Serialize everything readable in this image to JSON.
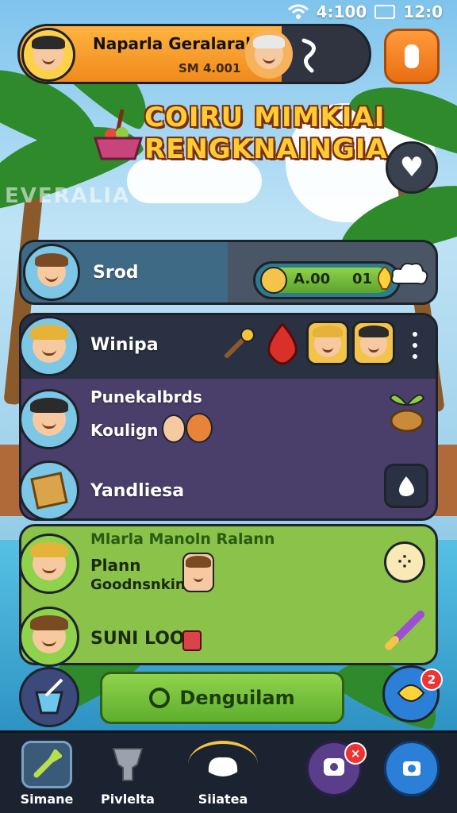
{
  "status_bar": {
    "time": "4:100",
    "battery": "12:0"
  },
  "profile": {
    "name": "Naparla Geralaral",
    "sub": "SM 4.001"
  },
  "title": {
    "line1": "COIRU MIMKIAI",
    "line2": "RENGKNAINGIA"
  },
  "watermark": "EVERALIA",
  "rows": [
    {
      "label": "Srod",
      "pill_value": "A.00",
      "pill_level": "01"
    },
    {
      "label": "Winipa"
    },
    {
      "label": "Punekalbrds",
      "sublabel": "Koulign"
    },
    {
      "label": "Yandliesa"
    },
    {
      "header": "Mlarla Manoln Ralann",
      "label": "Plann",
      "sublabel": "Goodnsnkin"
    },
    {
      "label": "SUNI LOOo"
    }
  ],
  "cta": {
    "label": "Denguilam"
  },
  "bottom_nav": [
    {
      "label": "Simane"
    },
    {
      "label": "Pivlelta"
    },
    {
      "label": "Siiatea"
    },
    {
      "label": ""
    },
    {
      "label": ""
    }
  ],
  "badges": {
    "gift": "2",
    "chat": "×"
  },
  "icons": [
    "wifi-icon",
    "battery-icon",
    "menu-icon",
    "heart-icon",
    "cloud-icon",
    "more-icon",
    "leaf-icon",
    "seed-icon",
    "dots-icon",
    "brush-icon",
    "bucket-icon",
    "gift-icon",
    "hammer-icon",
    "trophy-icon",
    "sheep-icon",
    "chat-icon",
    "camera-icon"
  ],
  "colors": {
    "accent_orange": "#f08a1c",
    "accent_green": "#5fae2d",
    "panel_dark": "#2f3440",
    "panel_purple": "#4a3f6b"
  }
}
